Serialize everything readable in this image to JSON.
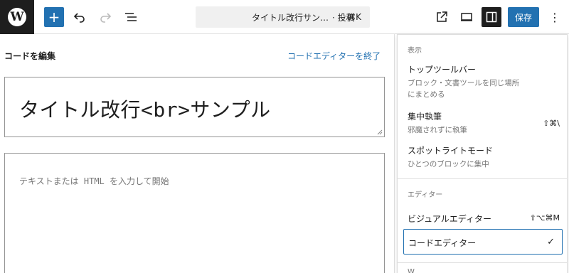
{
  "toolbar": {
    "logo_letter": "W",
    "add_symbol": "+",
    "document_title": "タイトル改行サン…",
    "post_type": "· 投稿",
    "command_shortcut": "⌘K",
    "save_label": "保存",
    "more_symbol": "⋮",
    "accent": "#2271b1"
  },
  "editor": {
    "header": "コードを編集",
    "exit_label": "コードエディターを終了",
    "title_value": "タイトル改行<br>サンプル",
    "content_placeholder": "テキストまたは HTML を入力して開始"
  },
  "menu": {
    "view_section": "表示",
    "items": [
      {
        "label": "トップツールバー",
        "desc": "ブロック・文書ツールを同じ場所\nにまとめる",
        "shortcut": ""
      },
      {
        "label": "集中執筆",
        "desc": "邪魔されずに執筆",
        "shortcut": "⇧⌘\\"
      },
      {
        "label": "スポットライトモード",
        "desc": "ひとつのブロックに集中",
        "shortcut": ""
      }
    ],
    "editor_section": "エディター",
    "editors": [
      {
        "label": "ビジュアルエディター",
        "shortcut": "⇧⌥⌘M"
      },
      {
        "label": "コードエディター",
        "check": "✓"
      }
    ],
    "cut_section": "W"
  }
}
